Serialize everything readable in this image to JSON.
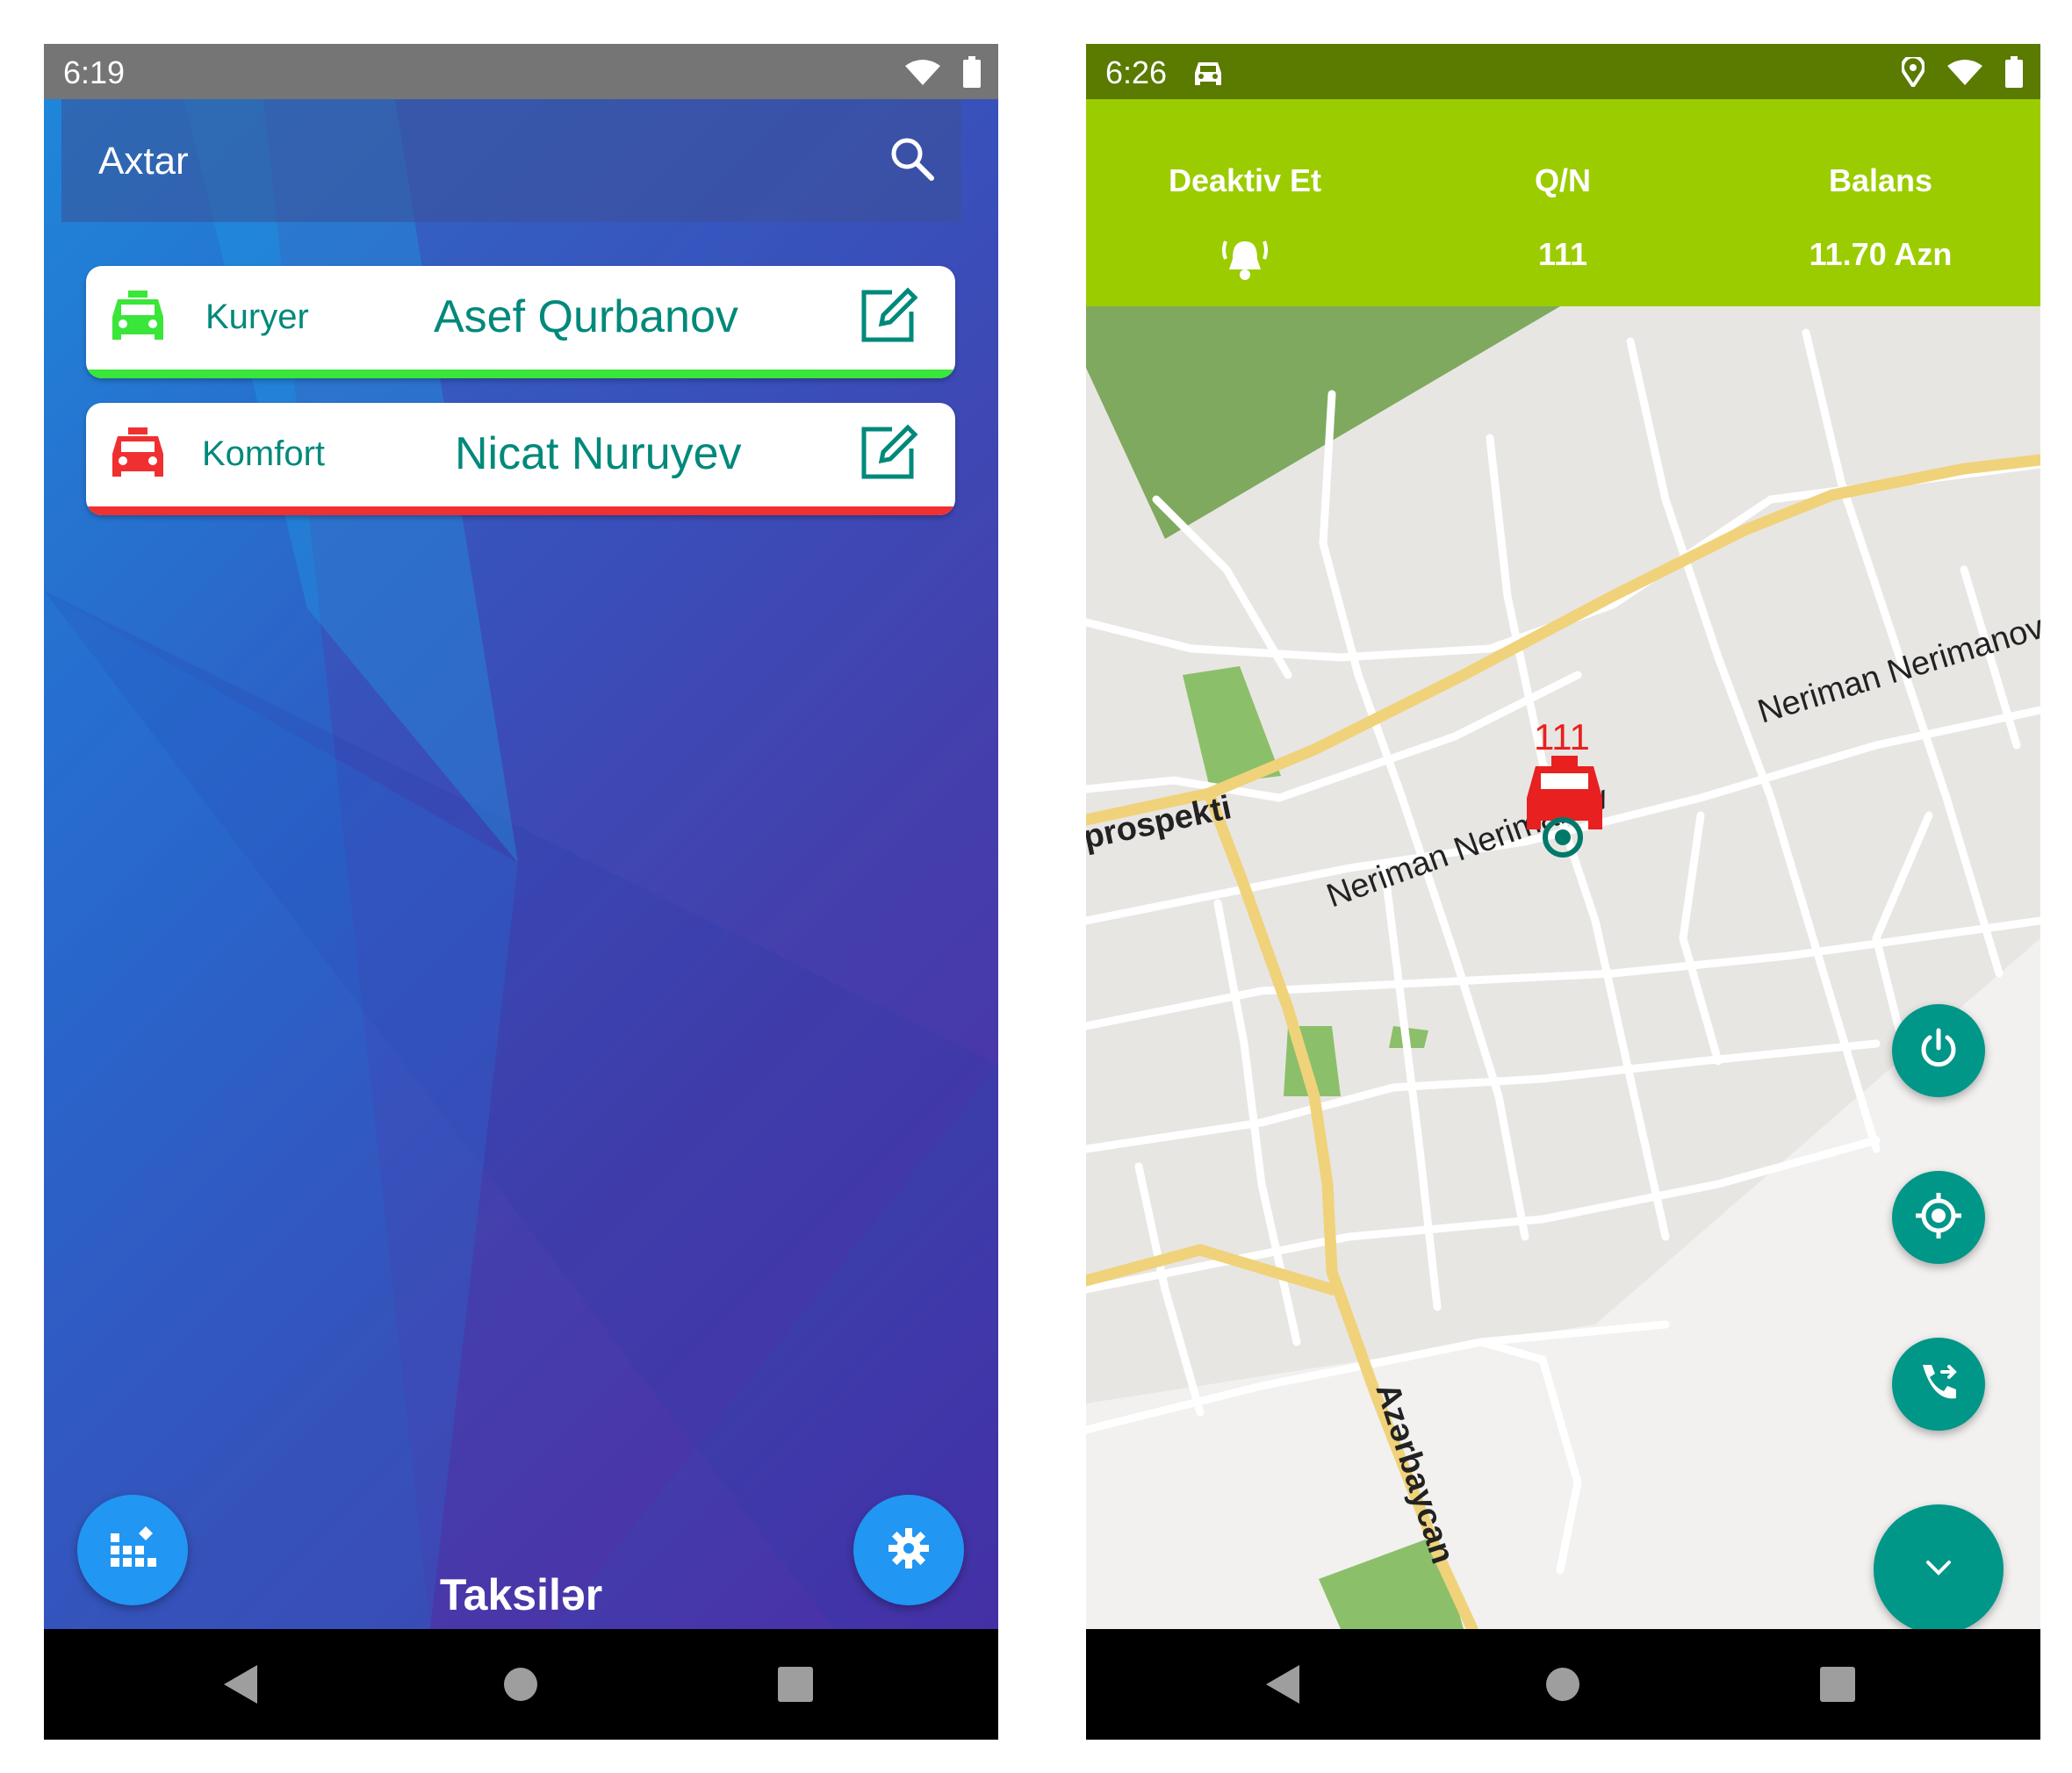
{
  "left_screen": {
    "status_time": "6:19",
    "search_label": "Axtar",
    "cards": [
      {
        "type": "Kuryer",
        "name": "Asef Qurbanov",
        "color": "#39e639"
      },
      {
        "type": "Komfort",
        "name": "Nicat Nuruyev",
        "color": "#f03030"
      }
    ],
    "bottom_title": "Taksilər",
    "icons": [
      "wifi-icon",
      "battery-icon",
      "search-icon",
      "taxi-icon",
      "edit-icon",
      "grid-icon",
      "gear-icon"
    ]
  },
  "right_screen": {
    "status_time": "6:26",
    "header": {
      "deactivate_label": "Deaktiv Et",
      "qn_label": "Q/N",
      "qn_value": "111",
      "balance_label": "Balans",
      "balance_value": "11.70 Azn"
    },
    "map": {
      "marker_label": "111",
      "street_labels": [
        "prospekti",
        "Neriman Nerimanov",
        "Neriman Nerimanov",
        "Azərbaycan"
      ]
    },
    "icons": [
      "car-icon",
      "location-icon",
      "wifi-icon",
      "battery-icon",
      "alarm-icon",
      "power-icon",
      "target-icon",
      "call-forward-icon",
      "chevron-down-icon"
    ]
  },
  "colors": {
    "accent_teal": "#009688",
    "header_green": "#9bcc00",
    "statusbar_green": "#5a7a00",
    "fab_blue": "#2196f3"
  }
}
